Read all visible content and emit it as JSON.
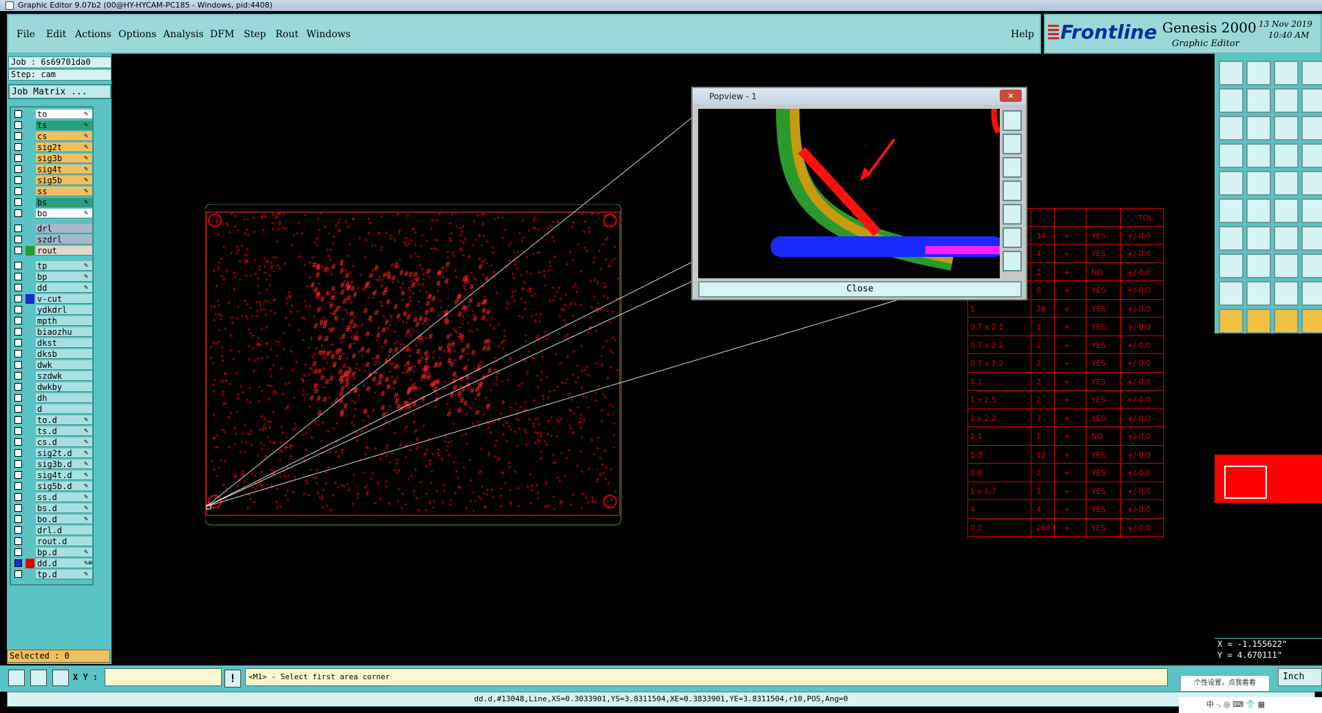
{
  "window": {
    "title": "Graphic Editor 9.07b2 (00@HY-HYCAM-PC185 - Windows, pid:4408)"
  },
  "menu": {
    "items": [
      "File",
      "Edit",
      "Actions",
      "Options",
      "Analysis",
      "DFM",
      "Step",
      "Rout",
      "Windows"
    ],
    "help": "Help"
  },
  "brand": {
    "logo": "Frontline",
    "product": "Genesis 2000",
    "subtitle": "Graphic Editor",
    "date": "13 Nov 2019",
    "time": "10:40 AM"
  },
  "job": {
    "label": "Job : 6s69701da0",
    "step": "Step: cam",
    "matrix_button": "Job Matrix ..."
  },
  "layers": [
    {
      "name": "to",
      "color": "#ffffff",
      "icon": "✎",
      "group": 1
    },
    {
      "name": "ts",
      "color": "#2aa080",
      "icon": "✎",
      "group": 1
    },
    {
      "name": "cs",
      "color": "#f0c060",
      "icon": "✎",
      "group": 1
    },
    {
      "name": "sig2t",
      "color": "#f0c060",
      "icon": "✎",
      "group": 1
    },
    {
      "name": "sig3b",
      "color": "#f0c060",
      "icon": "✎",
      "group": 1
    },
    {
      "name": "sig4t",
      "color": "#f0c060",
      "icon": "✎",
      "group": 1
    },
    {
      "name": "sig5b",
      "color": "#f0c060",
      "icon": "✎",
      "group": 1
    },
    {
      "name": "ss",
      "color": "#f0c060",
      "icon": "✎",
      "group": 1
    },
    {
      "name": "bs",
      "color": "#2aa080",
      "icon": "✎",
      "group": 1
    },
    {
      "name": "bo",
      "color": "#ffffff",
      "icon": "✎",
      "group": 1
    },
    {
      "name": "drl",
      "color": "#a8b8c8",
      "icon": "",
      "group": 2
    },
    {
      "name": "szdrl",
      "color": "#a8b8c8",
      "icon": "",
      "group": 2
    },
    {
      "name": "rout",
      "color": "#e0d8c8",
      "icon": "",
      "group": 2,
      "swatch": "#2a9a2a"
    },
    {
      "name": "tp",
      "color": "#a8e0e0",
      "icon": "✎",
      "group": 3
    },
    {
      "name": "bp",
      "color": "#a8e0e0",
      "icon": "✎",
      "group": 3
    },
    {
      "name": "dd",
      "color": "#a8e0e0",
      "icon": "✎",
      "group": 3
    },
    {
      "name": "v-cut",
      "color": "#a8e0e0",
      "icon": "",
      "group": 3,
      "swatch": "#1a2ad0"
    },
    {
      "name": "ydkdrl",
      "color": "#a8e0e0",
      "icon": "",
      "group": 3
    },
    {
      "name": "mpth",
      "color": "#a8e0e0",
      "icon": "",
      "group": 3
    },
    {
      "name": "biaozhu",
      "color": "#a8e0e0",
      "icon": "",
      "group": 3
    },
    {
      "name": "dkst",
      "color": "#a8e0e0",
      "icon": "",
      "group": 3
    },
    {
      "name": "dksb",
      "color": "#a8e0e0",
      "icon": "",
      "group": 3
    },
    {
      "name": "dwk",
      "color": "#a8e0e0",
      "icon": "",
      "group": 3
    },
    {
      "name": "szdwk",
      "color": "#a8e0e0",
      "icon": "",
      "group": 3
    },
    {
      "name": "dwkby",
      "color": "#a8e0e0",
      "icon": "",
      "group": 3
    },
    {
      "name": "dh",
      "color": "#a8e0e0",
      "icon": "",
      "group": 3
    },
    {
      "name": "d",
      "color": "#a8e0e0",
      "icon": "",
      "group": 3
    },
    {
      "name": "to.d",
      "color": "#a8e0e0",
      "icon": "✎",
      "group": 3
    },
    {
      "name": "ts.d",
      "color": "#a8e0e0",
      "icon": "✎",
      "group": 3
    },
    {
      "name": "cs.d",
      "color": "#a8e0e0",
      "icon": "✎",
      "group": 3
    },
    {
      "name": "sig2t.d",
      "color": "#a8e0e0",
      "icon": "✎",
      "group": 3
    },
    {
      "name": "sig3b.d",
      "color": "#a8e0e0",
      "icon": "✎",
      "group": 3
    },
    {
      "name": "sig4t.d",
      "color": "#a8e0e0",
      "icon": "✎",
      "group": 3
    },
    {
      "name": "sig5b.d",
      "color": "#a8e0e0",
      "icon": "✎",
      "group": 3
    },
    {
      "name": "ss.d",
      "color": "#a8e0e0",
      "icon": "✎",
      "group": 3
    },
    {
      "name": "bs.d",
      "color": "#a8e0e0",
      "icon": "✎",
      "group": 3
    },
    {
      "name": "bo.d",
      "color": "#a8e0e0",
      "icon": "✎",
      "group": 3
    },
    {
      "name": "drl.d",
      "color": "#a8e0e0",
      "icon": "",
      "group": 3
    },
    {
      "name": "rout.d",
      "color": "#a8e0e0",
      "icon": "",
      "group": 3
    },
    {
      "name": "bp.d",
      "color": "#a8e0e0",
      "icon": "✎",
      "group": 3
    },
    {
      "name": "dd.d",
      "color": "#a8e0e0",
      "icon": "✎≡",
      "group": 3,
      "swatch": "#e00000",
      "checked": true
    },
    {
      "name": "tp.d",
      "color": "#a8e0e0",
      "icon": "✎",
      "group": 3
    }
  ],
  "selected": "Selected : 0",
  "xy_label": "X Y :",
  "message": "<M1> - Select first area corner",
  "status": "dd.d,#13048,Line,XS=0.3033901,YS=3.8311504,XE=0.3833901,YE=3.8311504,r10,POS,Ang=0",
  "coords": {
    "x": "X = -1.155622\"",
    "y": "Y = 4.670111\""
  },
  "unit": "Inch",
  "popview": {
    "title": "Popview - 1",
    "close_x": "✕",
    "close_button": "Close"
  },
  "table": {
    "header": "TOL",
    "rows": [
      [
        "",
        "34",
        "YES",
        "+/-0.0"
      ],
      [
        "",
        "4",
        "YES",
        "+/-0.0"
      ],
      [
        "",
        "2",
        "NO",
        "+/-0.0"
      ],
      [
        "",
        "8",
        "YES",
        "+/-0.0"
      ],
      [
        "1",
        "28",
        "YES",
        "+/-0.0"
      ],
      [
        "0.7 x 2.1",
        "1",
        "YES",
        "+/-0.0"
      ],
      [
        "0.7 x 2.2",
        "1",
        "YES",
        "+/-0.0"
      ],
      [
        "0.7 x 1.2",
        "2",
        "YES",
        "+/-0.0"
      ],
      [
        "1.1",
        "2",
        "YES",
        "+/-0.0"
      ],
      [
        "1 x 2.5",
        "2",
        "YES",
        "+/-0.0"
      ],
      [
        "1 x 2.2",
        "3",
        "YES",
        "+/-0.0"
      ],
      [
        "2.1",
        "1",
        "NO",
        "+/-0.0"
      ],
      [
        "1.3",
        "12",
        "YES",
        "+/-0.0"
      ],
      [
        "0.8",
        "2",
        "YES",
        "+/-0.0"
      ],
      [
        "1 x 1.7",
        "3",
        "YES",
        "+/-0.0"
      ],
      [
        "4",
        "4",
        "YES",
        "+/-0.0"
      ],
      [
        "0.2",
        "2607",
        "YES",
        "+/-0.0"
      ]
    ]
  },
  "tooltip": "个性设置，点我看看",
  "tray": "中 ·, ◎ ⌨ 👕 ▦",
  "colors": {
    "panel": "#5ac3c3",
    "menu": "#9bd9d9",
    "board": "#e00000"
  }
}
